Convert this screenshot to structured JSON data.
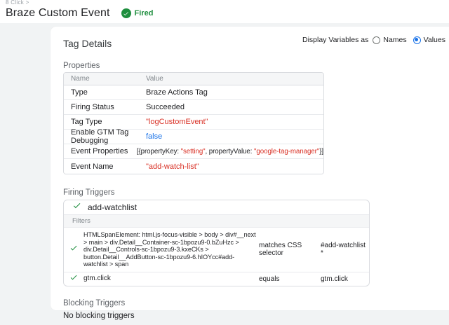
{
  "header": {
    "breadcrumb": "8 Click >",
    "title": "Braze Custom Event",
    "status_badge": "Fired"
  },
  "display_variables": {
    "label": "Display Variables as",
    "options": [
      {
        "label": "Names",
        "selected": false
      },
      {
        "label": "Values",
        "selected": true
      }
    ]
  },
  "tag_details": {
    "title": "Tag Details",
    "properties": {
      "title": "Properties",
      "columns": {
        "name": "Name",
        "value": "Value"
      },
      "rows": [
        {
          "name": "Type",
          "value": "Braze Actions Tag"
        },
        {
          "name": "Firing Status",
          "value": "Succeeded"
        },
        {
          "name": "Tag Type",
          "value": "\"logCustomEvent\""
        },
        {
          "name": "Enable GTM Tag Debugging",
          "value": "false"
        },
        {
          "name": "Event Properties",
          "value_parts": [
            "[{propertyKey: ",
            "\"setting\"",
            ", propertyValue: ",
            "\"google-tag-manager\"",
            "}]"
          ]
        },
        {
          "name": "Event Name",
          "value": "\"add-watch-list\""
        }
      ]
    }
  },
  "firing_triggers": {
    "title": "Firing Triggers",
    "trigger_name": "add-watchlist",
    "filters_header": "Filters",
    "filters": [
      {
        "condition": "HTMLSpanElement: html.js-focus-visible > body > div#__next > main > div.Detail__Container-sc-1bpozu9-0.bZuHzc > div.Detail__Controls-sc-1bpozu9-3.kxeCKs > button.Detail__AddButton-sc-1bpozu9-6.hIOYcc#add-watchlist > span",
        "operator": "matches CSS selector",
        "value": "#add-watchlist *"
      },
      {
        "condition": "gtm.click",
        "operator": "equals",
        "value": "gtm.click"
      }
    ]
  },
  "blocking_triggers": {
    "title": "Blocking Triggers",
    "empty_text": "No blocking triggers"
  },
  "colors": {
    "accent_green": "#1e8e3e",
    "error_red": "#d93025",
    "link_blue": "#1a73e8",
    "page_background": "#f1f3f4"
  }
}
